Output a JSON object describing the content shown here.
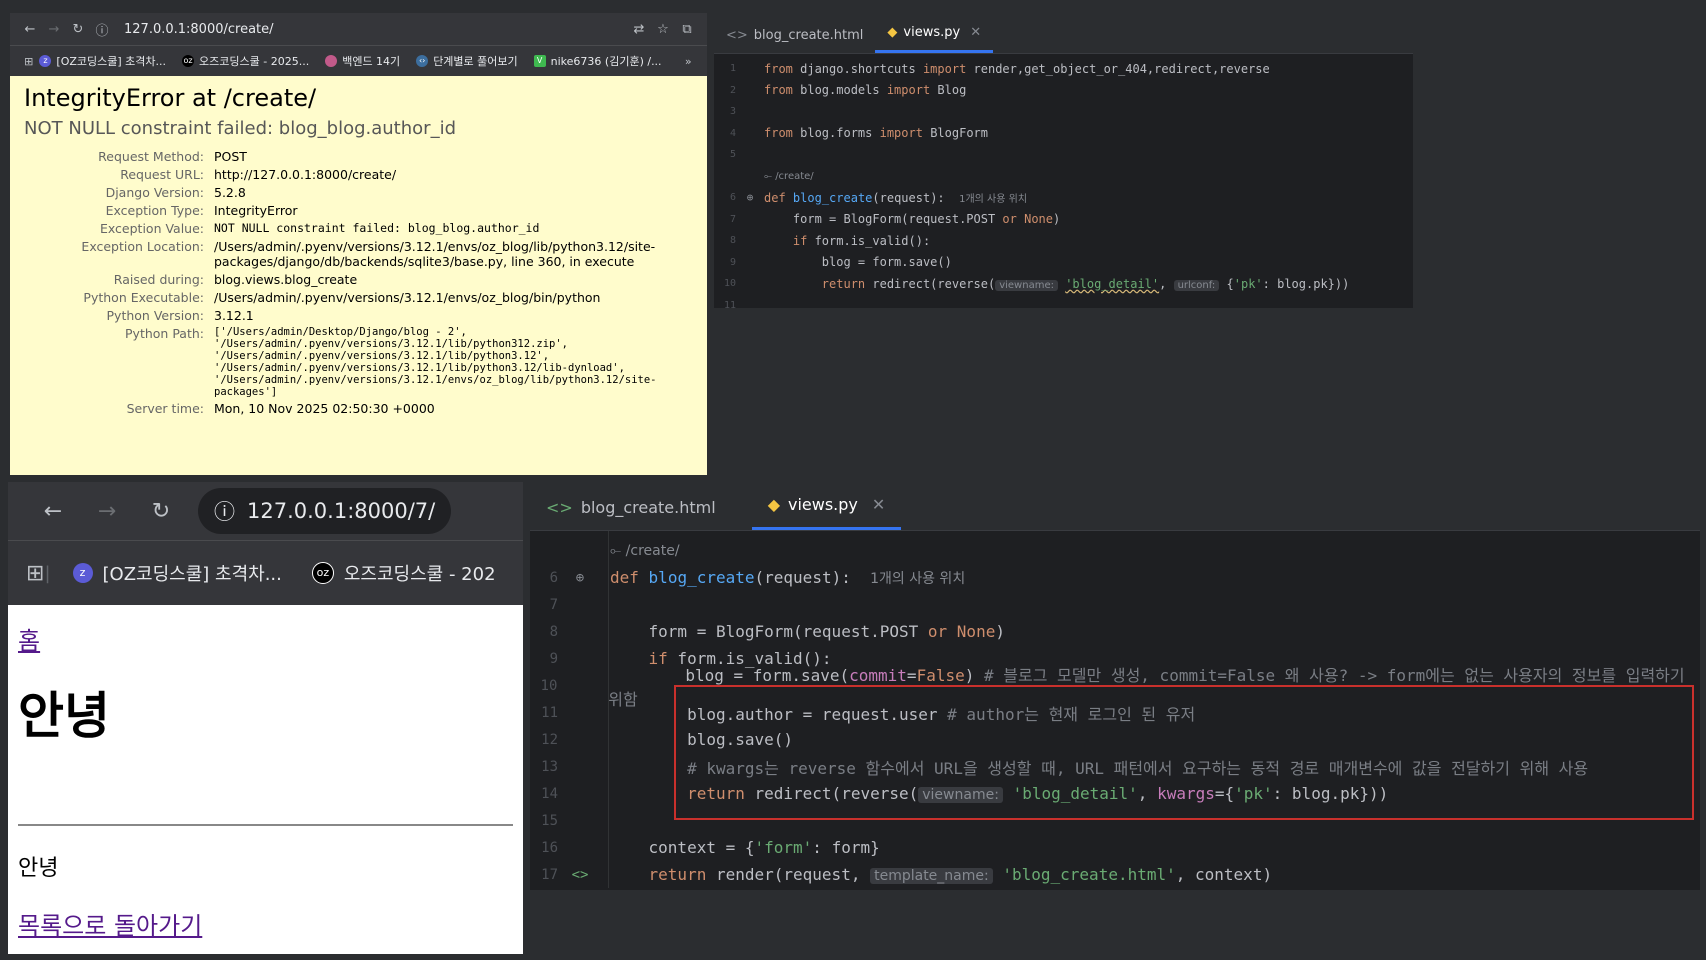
{
  "browser_top": {
    "url": "127.0.0.1:8000/create/",
    "bookmarks": [
      "[OZ코딩스쿨] 초격차...",
      "오즈코딩스쿨 - 2025...",
      "백엔드 14기",
      "단계별로 풀어보기",
      "nike6736 (김기훈) /..."
    ],
    "error_title": "IntegrityError at /create/",
    "error_subtitle": "NOT NULL constraint failed: blog_blog.author_id",
    "meta": [
      {
        "key": "Request Method:",
        "value": "POST"
      },
      {
        "key": "Request URL:",
        "value": "http://127.0.0.1:8000/create/"
      },
      {
        "key": "Django Version:",
        "value": "5.2.8"
      },
      {
        "key": "Exception Type:",
        "value": "IntegrityError"
      },
      {
        "key": "Exception Value:",
        "value": "NOT NULL constraint failed: blog_blog.author_id"
      },
      {
        "key": "Exception Location:",
        "value": "/Users/admin/.pyenv/versions/3.12.1/envs/oz_blog/lib/python3.12/site-packages/django/db/backends/sqlite3/base.py, line 360, in execute"
      },
      {
        "key": "Raised during:",
        "value": "blog.views.blog_create"
      },
      {
        "key": "Python Executable:",
        "value": "/Users/admin/.pyenv/versions/3.12.1/envs/oz_blog/bin/python"
      },
      {
        "key": "Python Version:",
        "value": "3.12.1"
      },
      {
        "key": "Python Path:",
        "value": "['/Users/admin/Desktop/Django/blog - 2', '/Users/admin/.pyenv/versions/3.12.1/lib/python312.zip', '/Users/admin/.pyenv/versions/3.12.1/lib/python3.12', '/Users/admin/.pyenv/versions/3.12.1/lib/python3.12/lib-dynload', '/Users/admin/.pyenv/versions/3.12.1/envs/oz_blog/lib/python3.12/site-packages']"
      },
      {
        "key": "Server time:",
        "value": "Mon, 10 Nov 2025 02:50:30 +0000"
      }
    ]
  },
  "editor_top": {
    "tabs": [
      "blog_create.html",
      "views.py"
    ],
    "route_label": "/create/",
    "usage_label": "1개의 사용 위치",
    "hint_viewname": "viewname:",
    "hint_urlconf": "urlconf:"
  },
  "browser_bottom": {
    "url": "127.0.0.1:8000/7/",
    "bookmarks": [
      "[OZ코딩스쿨] 초격차...",
      "오즈코딩스쿨 - 202"
    ],
    "home_link": "홈",
    "title": "안녕",
    "content": "안녕",
    "back_link": "목록으로 돌아가기"
  },
  "editor_bottom": {
    "tabs": [
      "blog_create.html",
      "views.py"
    ],
    "route_label": "/create/",
    "usage_label": "1개의 사용 위치",
    "hint_viewname": "viewname:",
    "hint_template": "template_name:",
    "comment_10": "# 블로그 모델만 생성, commit=False 왜 사용? -> form에는 없는 사용자의 정보를 입력하기 위함",
    "comment_11": "# author는 현재 로그인 된 유저",
    "comment_13": "# kwargs는 reverse 함수에서 URL을 생성할 때, URL 패턴에서 요구하는 동적 경로 매개변수에 값을 전달하기 위해 사용"
  },
  "colors": {
    "accent": "#3574f0",
    "highlight_border": "#c9302c",
    "django_bg": "#fffccc"
  }
}
